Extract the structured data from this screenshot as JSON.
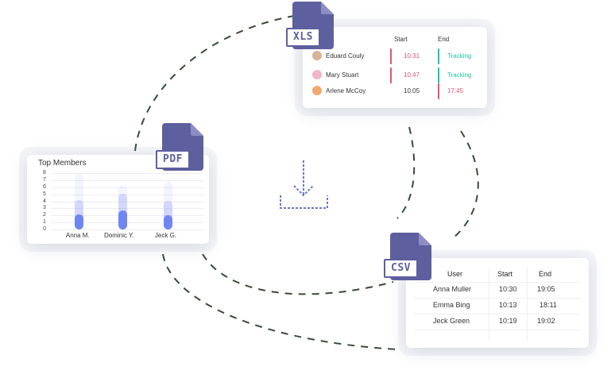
{
  "xls": {
    "badge": "XLS",
    "col_start": "Start",
    "col_end": "End",
    "rows": [
      {
        "name": "Eduard Couly",
        "start": "10:31",
        "end": "Tracking"
      },
      {
        "name": "Mary Stuart",
        "start": "10:47",
        "end": "Tracking"
      },
      {
        "name": "Arlene McCoy",
        "start": "10:05",
        "end": "17:45"
      }
    ]
  },
  "pdf": {
    "badge": "PDF",
    "title": "Top Members",
    "y_ticks": [
      "8",
      "7",
      "6",
      "5",
      "4",
      "3",
      "2",
      "1",
      "0"
    ],
    "members": [
      "Anna M.",
      "Dominic Y.",
      "Jeck G."
    ]
  },
  "csv": {
    "badge": "CSV",
    "col_user": "User",
    "col_start": "Start",
    "col_end": "End",
    "rows": [
      {
        "user": "Anna Muller",
        "start": "10:30",
        "end": "19:05"
      },
      {
        "user": "Emma Bing",
        "start": "10:13",
        "end": "18:11"
      },
      {
        "user": "Jeck Green",
        "start": "10:19",
        "end": "19:02"
      }
    ]
  },
  "colors": {
    "accent": "#5e5f9e",
    "tracking": "#1fc7a0",
    "late": "#e0566f",
    "bar": "#6f86f2",
    "dash": "#2c4230"
  },
  "icons": [
    "download-icon",
    "xls-file-icon",
    "pdf-file-icon",
    "csv-file-icon"
  ],
  "chart_data": {
    "type": "bar",
    "title": "Top Members",
    "categories": [
      "Anna M.",
      "Dominic Y.",
      "Jeck G."
    ],
    "values": [
      3.3,
      4.2,
      3.2
    ],
    "ylim": [
      0,
      8
    ],
    "grid": true
  }
}
